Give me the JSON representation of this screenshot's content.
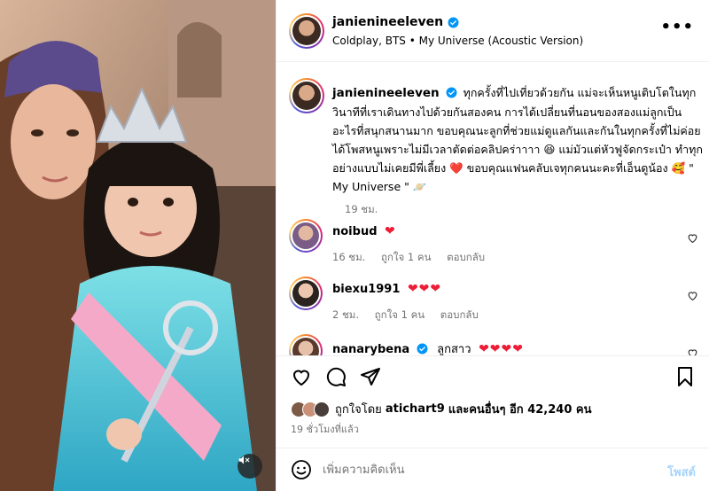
{
  "post": {
    "username": "janienineeleven",
    "music": "Coldplay, BTS • My Universe (Acoustic Version)",
    "more_label": "•••"
  },
  "caption": {
    "username": "janienineeleven",
    "text": "ทุกครั้งที่ไปเที่ยวด้วยกัน แม่จะเห็นหนูเติบโตในทุกวินาทีที่เราเดินทางไปด้วยกันสองคน การได้เปลี่ยนที่นอนของสองแม่ลูกเป็นอะไรที่สนุกสนานมาก ขอบคุณนะลูกที่ช่วยแม่ดูแลกันและกันในทุกครั้งที่ไม่ค่อยได้โพสหนูเพราะไม่มีเวลาตัดต่อคลิปคร่าาาา 😆 แม่มัวแต่หัวฟูจัดกระเป๋า ทำทุกอย่างแบบไม่เคยมีพี่เลี้ยง ❤️ ขอบคุณแฟนคลับเจทุกคนนะคะที่เอ็นดูน้อง 🥰 \" My Universe \" 🪐",
    "time": "19 ชม."
  },
  "comments": [
    {
      "username": "noibud",
      "text": "",
      "hearts": "❤",
      "time": "16 ชม.",
      "likes": "ถูกใจ 1 คน",
      "reply": "ตอบกลับ"
    },
    {
      "username": "biexu1991",
      "text": "",
      "hearts": "❤❤❤",
      "time": "2 ชม.",
      "likes": "ถูกใจ 1 คน",
      "reply": "ตอบกลับ"
    },
    {
      "username": "nanarybena",
      "text": "ลูกสาว",
      "hearts": "❤❤❤❤",
      "time": "",
      "likes": "",
      "reply": ""
    }
  ],
  "likes": {
    "prefix": "ถูกใจโดย",
    "user": "atichart9",
    "suffix": "และคนอื่นๆ อีก 42,240 คน"
  },
  "post_time": "19 ชั่วโมงที่แล้ว",
  "add_comment": {
    "placeholder": "เพิ่มความคิดเห็น",
    "post_label": "โพสต์"
  },
  "colors": {
    "verified": "#0095f6",
    "heart": "#ed1d36",
    "post_button": "#a7d4fa"
  },
  "icons": {
    "like": "heart-outline-icon",
    "comment": "speech-bubble-icon",
    "share": "paper-plane-icon",
    "save": "bookmark-icon",
    "emoji": "smiley-icon",
    "mute": "speaker-muted-icon"
  }
}
